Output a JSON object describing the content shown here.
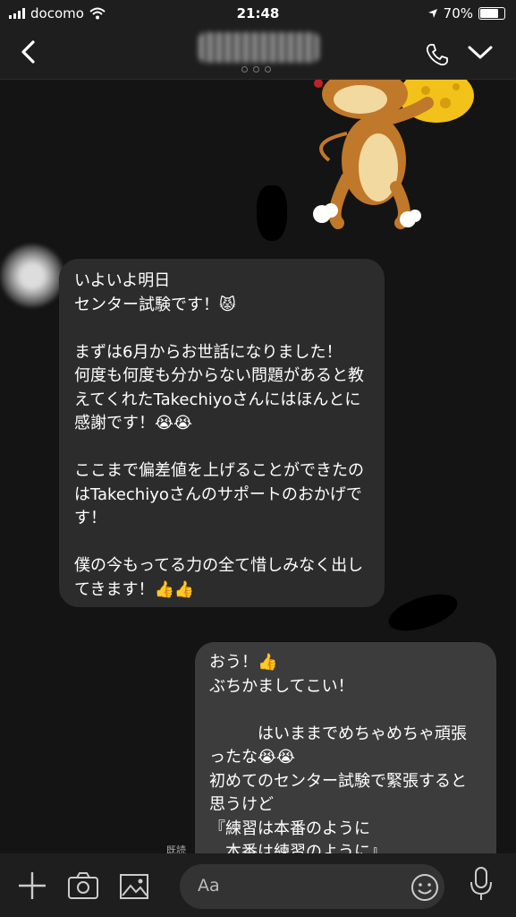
{
  "status": {
    "carrier": "docomo",
    "time": "21:48",
    "battery": "70%"
  },
  "chat": {
    "incoming_text": "いよいよ明日\nセンター試験です！😾\n\nまずは6月からお世話になりました！\n何度も何度も分からない問題があると教えてくれたTakechiyoさんにはほんとに感謝です！😭😭\n\nここまで偏差値を上げることができたのはTakechiyoさんのサポートのおかげです！\n\n僕の今もってる力の全て惜しみなく出してきます！👍👍",
    "outgoing_text": "おう！👍\nぶちかましてこい！\n\n　　　はいままでめちゃめちゃ頑張ったな😭😭\n初めてのセンター試験で緊張すると思うけど\n『練習は本番のように\n　本番は練習のように』",
    "read_label": "既読"
  },
  "input": {
    "placeholder": "Aa"
  },
  "icons": {
    "back": "chevron-left-icon",
    "call": "phone-icon",
    "menu": "chevron-down-icon",
    "add": "plus-icon",
    "camera": "camera-icon",
    "image": "image-icon",
    "emoji": "smiley-icon",
    "mic": "microphone-icon"
  }
}
